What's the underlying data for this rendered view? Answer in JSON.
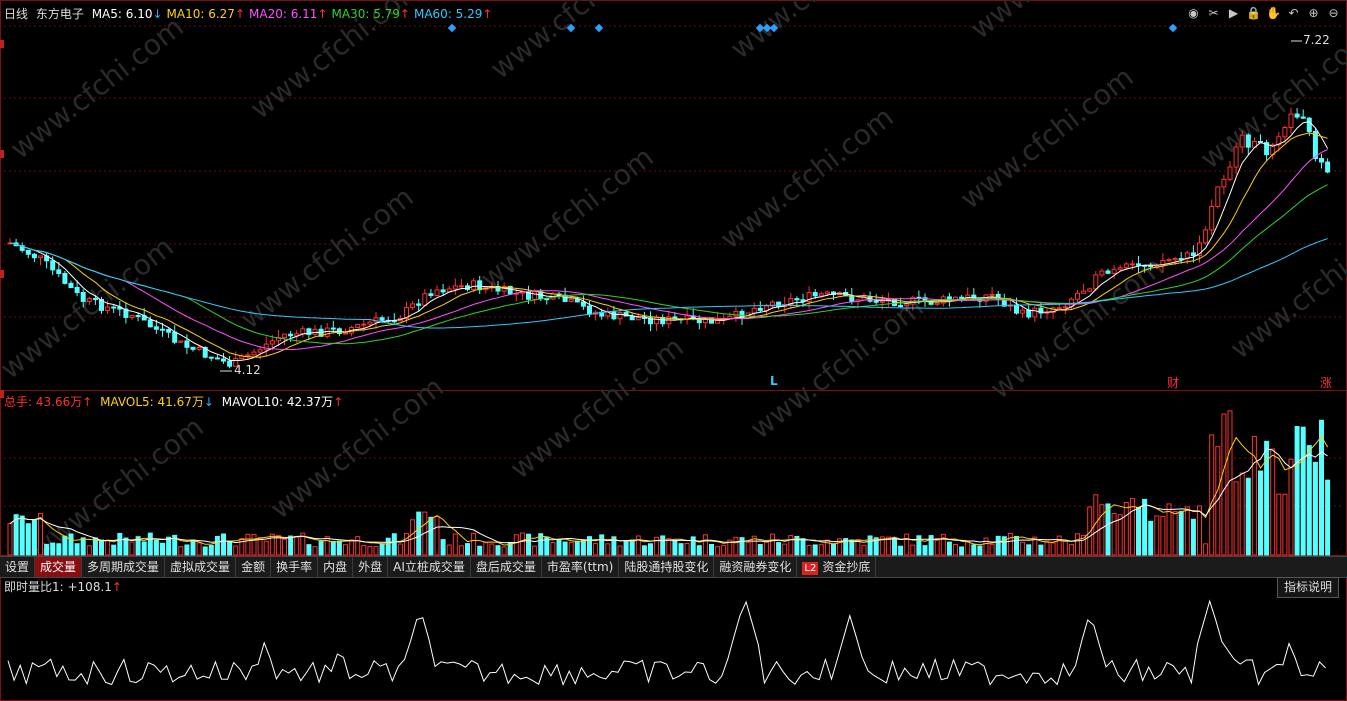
{
  "header": {
    "period": "日线",
    "stock_name": "东方电子",
    "ma": [
      {
        "label": "MA5: 6.10",
        "arrow": "↓",
        "color": "#ffffff"
      },
      {
        "label": "MA10: 6.27",
        "arrow": "↑",
        "color": "#ffd200"
      },
      {
        "label": "MA20: 6.11",
        "arrow": "↑",
        "color": "#ff50ff"
      },
      {
        "label": "MA30: 5.79",
        "arrow": "↑",
        "color": "#30d030"
      },
      {
        "label": "MA60: 5.29",
        "arrow": "↑",
        "color": "#30c8ff"
      }
    ]
  },
  "toolbar": {
    "icons": [
      "eye-icon",
      "scissors-icon",
      "play-icon",
      "lock-icon",
      "hand-icon",
      "undo-icon",
      "zoom-in-icon",
      "zoom-out-icon"
    ],
    "glyphs": [
      "◉",
      "✂",
      "▶",
      "🔒",
      "✋",
      "↶",
      "⊕",
      "⊖"
    ]
  },
  "price_panel": {
    "high_label": "7.22",
    "low_label": "4.12",
    "event_markers": [
      {
        "text": "L",
        "color": "#30c8ff"
      },
      {
        "text": "财",
        "color": "#ff3030"
      },
      {
        "text": "涨",
        "color": "#ff3030"
      }
    ],
    "candle_colors": {
      "up": "#ff3030",
      "down": "#54ffff"
    }
  },
  "volume_panel": {
    "total": {
      "label": "总手: 43.66万",
      "arrow": "↑",
      "color": "#ff3030"
    },
    "mavol5": {
      "label": "MAVOL5: 41.67万",
      "arrow": "↓",
      "color": "#ffd200"
    },
    "mavol10": {
      "label": "MAVOL10: 42.37万",
      "arrow": "↑",
      "color": "#ffffff"
    }
  },
  "tabs": [
    "设置",
    "成交量",
    "多周期成交量",
    "虚拟成交量",
    "金额",
    "换手率",
    "内盘",
    "外盘",
    "AI立桩成交量",
    "盘后成交量",
    "市盈率(ttm)",
    "陆股通持股变化",
    "融资融券变化",
    "资金抄底"
  ],
  "active_tab": "成交量",
  "l2_badge": "L2",
  "indicator_panel": {
    "label": "即时量比1: +108.1",
    "arrow": "↑",
    "help_button": "指标说明"
  },
  "watermark": "www.cfchi.com",
  "chart_data": {
    "type": "candlestick",
    "title": "东方电子",
    "high": 7.22,
    "low": 4.12,
    "ma_latest": {
      "MA5": 6.1,
      "MA10": 6.27,
      "MA20": 6.11,
      "MA30": 5.79,
      "MA60": 5.29
    },
    "volume_latest": {
      "total": "43.66万",
      "MAVOL5": "41.67万",
      "MAVOL10": "42.37万"
    },
    "indicator_latest": {
      "即时量比1": 108.1
    }
  }
}
